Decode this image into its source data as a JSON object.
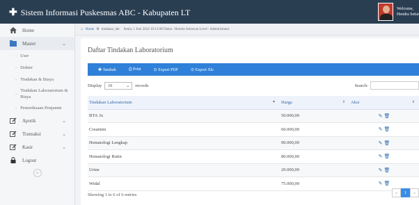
{
  "app": {
    "title": "Sistem Informasi Puskesmas ABC - Kabupaten LT"
  },
  "user": {
    "welcome": "Welcome,",
    "name": "Hendra Setiawan"
  },
  "sidebar": {
    "home": "Home",
    "master": "Master",
    "master_items": [
      "User",
      "Dokter",
      "Tindakan & Biaya",
      "Tindakan Laboratorium & Biaya",
      "Pemeriksaan Penjamin"
    ],
    "apotik": "Apotik",
    "transaksi": "Transaksi",
    "kasir": "Kasir",
    "logout": "Logout",
    "collapse": "«"
  },
  "breadcrumb": {
    "home": "Home",
    "page": "tindakan_lab",
    "session": "Senin, 1 Juni 2024 10:13:08 Nama : Hendra Setiawan Level : Administrator"
  },
  "panel": {
    "title": "Daftar Tindakan Laboratorium"
  },
  "toolbar": {
    "tambah": "Tambah",
    "print": "Print",
    "pdf": "Export PDF",
    "xls": "Export Xls"
  },
  "length": {
    "display": "Display",
    "value": "10",
    "records": "records"
  },
  "search": {
    "label": "Search:",
    "value": ""
  },
  "table": {
    "headers": [
      "Tindakan Laboratorium",
      "Harga",
      "Aksi"
    ],
    "rows": [
      [
        "BTA 3x",
        "50.000,00"
      ],
      [
        "Creatinin",
        "60.000,00"
      ],
      [
        "Hematologi Lengkap",
        "90.000,00"
      ],
      [
        "Hematologi Rutin",
        "80.000,00"
      ],
      [
        "Urine",
        "20.000,00"
      ],
      [
        "Widal",
        "75.000,00"
      ]
    ]
  },
  "footer": {
    "info": "Showing 1 to 6 of 6 entries",
    "prev": "«",
    "page": "1",
    "next": "»"
  },
  "colors": {
    "topbar": "#2a3e52",
    "accent": "#2f80d8"
  }
}
